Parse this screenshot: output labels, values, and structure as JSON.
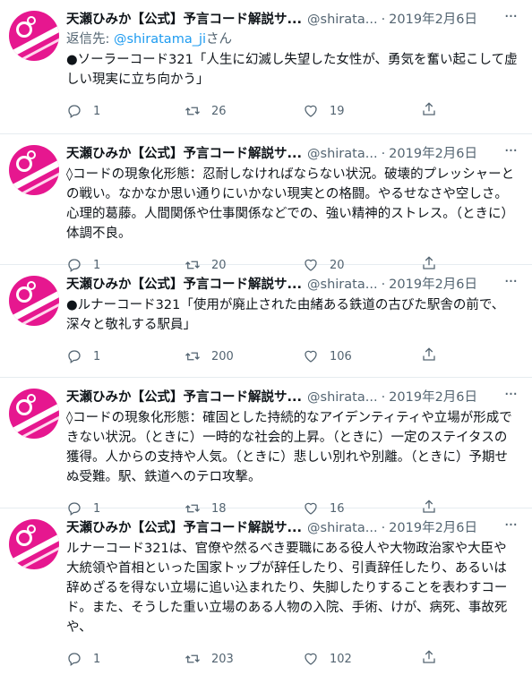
{
  "tweets": [
    {
      "name": "天瀬ひみか【公式】予言コード解説サ...",
      "handle": "@shirata...",
      "date": "2019年2月6日",
      "reply_prefix": "返信先: ",
      "reply_to": "@shiratama_ji",
      "reply_suffix": "さん",
      "text": "●ソーラーコード321「人生に幻滅し失望した女性が、勇気を奮い起こして虚しい現実に立ち向かう」",
      "replies": "1",
      "retweets": "26",
      "likes": "19"
    },
    {
      "name": "天瀬ひみか【公式】予言コード解説サ...",
      "handle": "@shirata...",
      "date": "2019年2月6日",
      "text": "◊コードの現象化形態：忍耐しなければならない状況。破壊的プレッシャーとの戦い。なかなか思い通りにいかない現実との格闘。やるせなさや空しさ。心理的葛藤。人間関係や仕事関係などでの、強い精神的ストレス。（ときに）体調不良。",
      "replies": "1",
      "retweets": "20",
      "likes": "20"
    },
    {
      "name": "天瀬ひみか【公式】予言コード解説サ...",
      "handle": "@shirata...",
      "date": "2019年2月6日",
      "text": "●ルナーコード321「使用が廃止された由緒ある鉄道の古びた駅舎の前で、深々と敬礼する駅員」",
      "replies": "1",
      "retweets": "200",
      "likes": "106"
    },
    {
      "name": "天瀬ひみか【公式】予言コード解説サ...",
      "handle": "@shirata...",
      "date": "2019年2月6日",
      "text": "◊コードの現象化形態：確固とした持続的なアイデンティティや立場が形成できない状況。（ときに）一時的な社会的上昇。（ときに）一定のステイタスの獲得。人からの支持や人気。（ときに）悲しい別れや別離。（ときに）予期せぬ受難。駅、鉄道へのテロ攻撃。",
      "replies": "1",
      "retweets": "18",
      "likes": "16"
    },
    {
      "name": "天瀬ひみか【公式】予言コード解説サ...",
      "handle": "@shirata...",
      "date": "2019年2月6日",
      "text": "ルナーコード321は、官僚や然るべき要職にある役人や大物政治家や大臣や大統領や首相といった国家トップが辞任したり、引責辞任したり、あるいは辞めざるを得ない立場に追い込まれたり、失脚したりすることを表わすコード。また、そうした重い立場のある人物の入院、手術、けが、病死、事故死や、",
      "replies": "1",
      "retweets": "203",
      "likes": "102"
    }
  ],
  "icons": {
    "reply": "reply-icon",
    "retweet": "retweet-icon",
    "like": "heart-icon",
    "share": "share-icon",
    "more": "more-icon"
  },
  "colors": {
    "avatar": "#e6178f",
    "link": "#1d9bf0",
    "secondary_text": "#536471"
  }
}
